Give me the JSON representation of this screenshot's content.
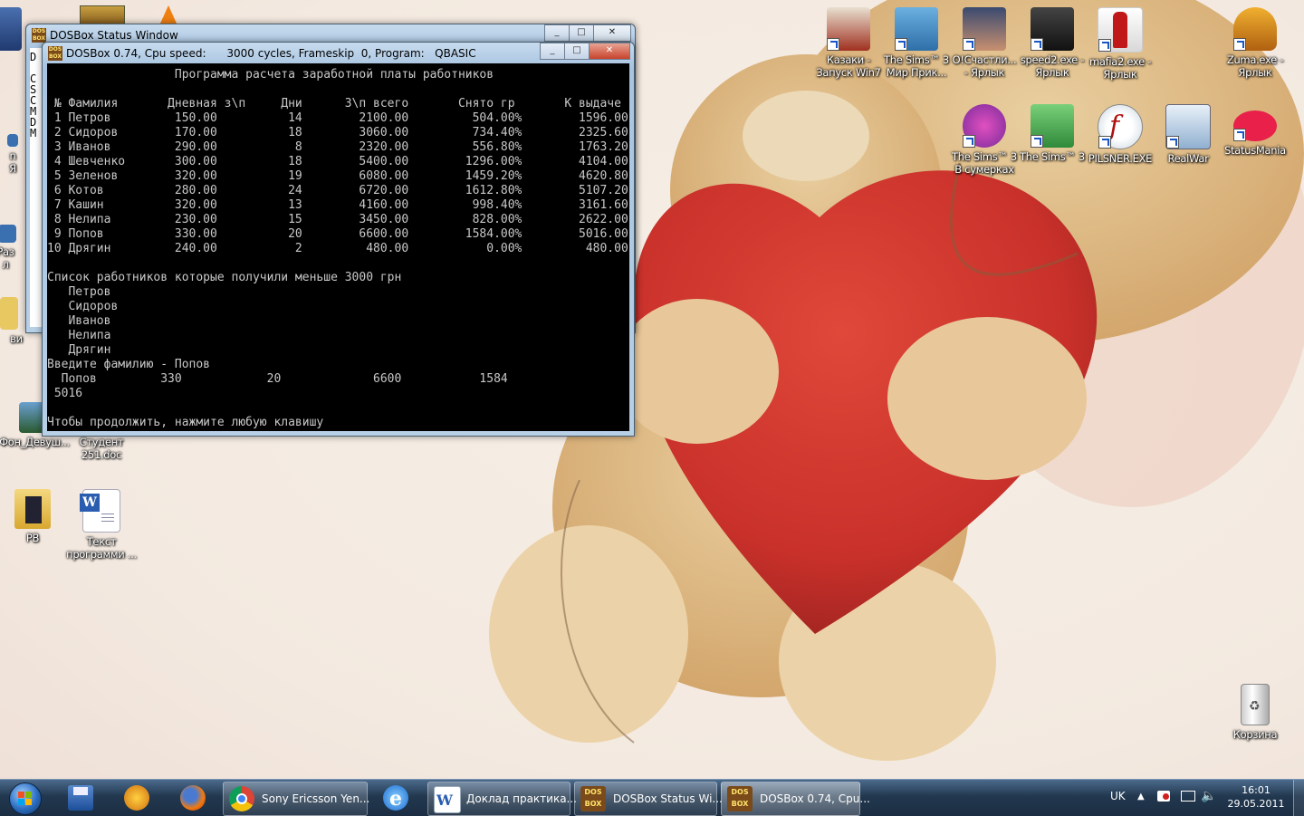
{
  "desktop": {
    "icons": [
      {
        "label": "Казаки -\nЗапуск Win7"
      },
      {
        "label": "The Sims™ 3\nМир Прик..."
      },
      {
        "label": "О!Счастли...\n- Ярлык"
      },
      {
        "label": "speed2.exe -\nЯрлык"
      },
      {
        "label": "mafia2.exe -\nЯрлык"
      },
      {
        "label": "Zuma.exe -\nЯрлык"
      },
      {
        "label": "The Sims™ 3\nВ сумерках"
      },
      {
        "label": "The Sims™ 3"
      },
      {
        "label": "PILSNER.EXE"
      },
      {
        "label": "RealWar"
      },
      {
        "label": "StatusMania"
      },
      {
        "label": "Фон_Девуш..."
      },
      {
        "label": "Студент\n251.doc"
      },
      {
        "label": "PB"
      },
      {
        "label": "Текст\nпрограмми ..."
      },
      {
        "label": "Корзина"
      }
    ],
    "partial_left_labels": [
      "Раз\nл",
      "ви",
      "n\nЯ"
    ]
  },
  "status_window": {
    "title": "DOSBox Status Window",
    "left_chars": [
      "D",
      "C",
      "S",
      "C",
      "M",
      "D",
      "M"
    ]
  },
  "dosbox_window": {
    "title": "DOSBox 0.74, Cpu speed:      3000 cycles, Frameskip  0, Program:   QBASIC",
    "screen_lines": [
      "                  Программа расчета заработной платы работников",
      "",
      " № Фамилия       Дневная з\\п     Дни      З\\п всего       Снято гр       К выдаче",
      " 1 Петров         150.00          14        2100.00         504.00%        1596.00",
      " 2 Сидоров        170.00          18        3060.00         734.40%        2325.60",
      " 3 Иванов         290.00           8        2320.00         556.80%        1763.20",
      " 4 Шевченко       300.00          18        5400.00        1296.00%        4104.00",
      " 5 Зеленов        320.00          19        6080.00        1459.20%        4620.80",
      " 6 Котов          280.00          24        6720.00        1612.80%        5107.20",
      " 7 Кашин          320.00          13        4160.00         998.40%        3161.60",
      " 8 Нелипа         230.00          15        3450.00         828.00%        2622.00",
      " 9 Попов          330.00          20        6600.00        1584.00%        5016.00",
      "10 Дрягин         240.00           2         480.00           0.00%         480.00",
      "",
      "Список работников которые получили меньше 3000 грн",
      "   Петров",
      "   Сидоров",
      "   Иванов",
      "   Нелипа",
      "   Дрягин",
      "Введите фамилию - Попов",
      "  Попов         330            20             6600           1584",
      " 5016",
      "",
      "Чтобы продолжить, нажмите любую клавишу"
    ]
  },
  "taskbar": {
    "apps": [
      {
        "label": "Sony Ericsson Yen..."
      },
      {
        "label": "Доклад практика..."
      },
      {
        "label": "DOSBox Status Wi..."
      },
      {
        "label": "DOSBox 0.74, Cpu..."
      }
    ],
    "language": "UK",
    "time": "16:01",
    "date": "29.05.2011"
  }
}
